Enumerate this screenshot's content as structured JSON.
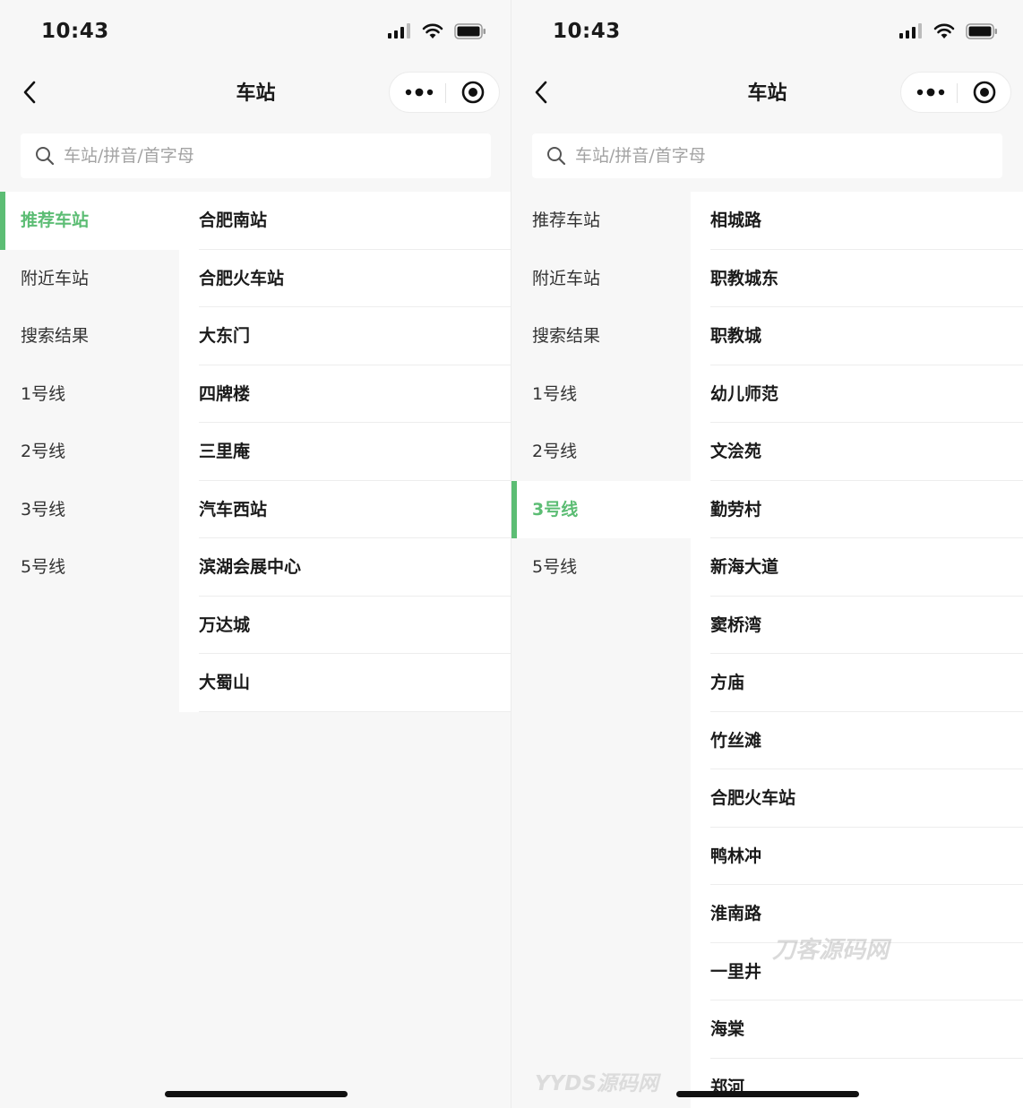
{
  "status": {
    "time": "10:43"
  },
  "nav": {
    "title": "车站"
  },
  "search": {
    "placeholder": "车站/拼音/首字母"
  },
  "colors": {
    "accent": "#5cbd74",
    "background": "#f7f7f7",
    "list_bg": "#ffffff"
  },
  "icons": [
    "back-chevron-icon",
    "more-dots-icon",
    "target-close-icon",
    "search-icon",
    "cellular-icon",
    "wifi-icon",
    "battery-icon"
  ],
  "left_screen": {
    "menu": [
      {
        "label": "推荐车站",
        "active": true
      },
      {
        "label": "附近车站",
        "active": false
      },
      {
        "label": "搜索结果",
        "active": false
      },
      {
        "label": "1号线",
        "active": false
      },
      {
        "label": "2号线",
        "active": false
      },
      {
        "label": "3号线",
        "active": false
      },
      {
        "label": "5号线",
        "active": false
      }
    ],
    "stations": [
      "合肥南站",
      "合肥火车站",
      "大东门",
      "四牌楼",
      "三里庵",
      "汽车西站",
      "滨湖会展中心",
      "万达城",
      "大蜀山"
    ]
  },
  "right_screen": {
    "menu": [
      {
        "label": "推荐车站",
        "active": false
      },
      {
        "label": "附近车站",
        "active": false
      },
      {
        "label": "搜索结果",
        "active": false
      },
      {
        "label": "1号线",
        "active": false
      },
      {
        "label": "2号线",
        "active": false
      },
      {
        "label": "3号线",
        "active": true
      },
      {
        "label": "5号线",
        "active": false
      }
    ],
    "stations": [
      "相城路",
      "职教城东",
      "职教城",
      "幼儿师范",
      "文浍苑",
      "勤劳村",
      "新海大道",
      "窦桥湾",
      "方庙",
      "竹丝滩",
      "合肥火车站",
      "鸭林冲",
      "淮南路",
      "一里井",
      "海棠",
      "郑河"
    ]
  },
  "watermarks": {
    "primary": "刀客源码网",
    "secondary": "YYDS源码网"
  }
}
